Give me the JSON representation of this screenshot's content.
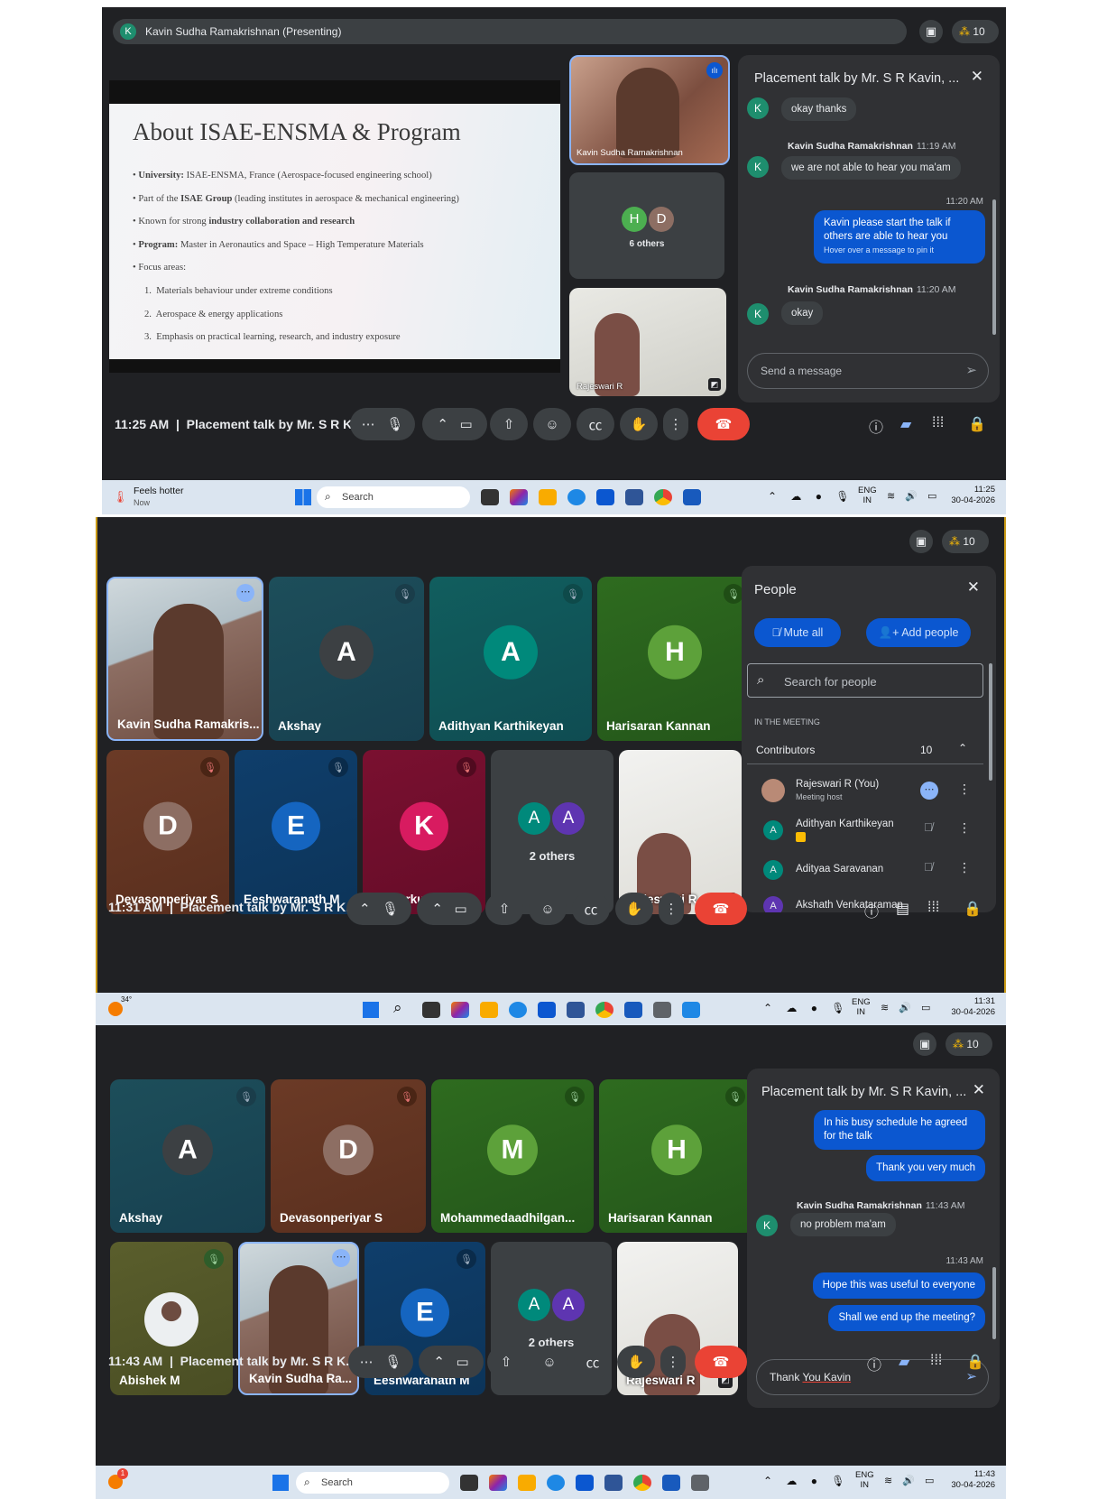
{
  "s1": {
    "presenting": "Kavin Sudha Ramakrishnan (Presenting)",
    "presenter_initial": "K",
    "count": "10",
    "slide": {
      "title": "About ISAE-ENSMA & Program",
      "b1_bold": "University:",
      "b1": " ISAE-ENSMA, France (Aerospace-focused engineering school)",
      "b2a": "Part of the ",
      "b2_bold": "ISAE Group",
      "b2b": " (leading institutes in aerospace & mechanical engineering)",
      "b3a": "Known for strong ",
      "b3_bold": "industry collaboration and research",
      "b4_bold": "Program:",
      "b4": " Master in Aeronautics and Space – High Temperature Materials",
      "b5": "Focus areas:",
      "n1": "Materials behaviour under extreme conditions",
      "n2": "Aerospace & energy applications",
      "n3": "Emphasis on practical learning, research, and industry exposure"
    },
    "tile_kavin": "Kavin Sudha Ramakrishnan",
    "others_label": "6 others",
    "others_i1": "H",
    "others_i2": "D",
    "tile_raj": "Rajeswari R",
    "chat": {
      "title": "Placement talk by Mr. S R Kavin, ...",
      "m0": "okay thanks",
      "sender1": "Kavin Sudha Ramakrishnan",
      "t1": "11:19 AM",
      "m1": "we are not able to hear you ma'am",
      "t2": "11:20 AM",
      "m2": "Kavin please start the talk if others are able to hear you",
      "m2_hint": "Hover over a message to pin it",
      "sender3": "Kavin Sudha Ramakrishnan",
      "t3": "11:20 AM",
      "m3": "okay",
      "input_placeholder": "Send a message"
    },
    "time": "11:25 AM",
    "meeting": "Placement talk by Mr. S R K...",
    "taskbar": {
      "weather": "Feels hotter",
      "weather_sub": "Now",
      "search": "Search",
      "lang1": "ENG",
      "lang2": "IN",
      "clock": "11:25",
      "date": "30-04-2026"
    }
  },
  "s2": {
    "count": "10",
    "tiles": [
      "Kavin Sudha Ramakris...",
      "Akshay",
      "Adithyan Karthikeyan",
      "Harisaran Kannan",
      "Devasonperiyar S",
      "Eeshwaranath M",
      "Kishorkumaar A",
      "2 others",
      "Rajeswari R"
    ],
    "initials": [
      "A",
      "A",
      "H",
      "D",
      "E",
      "K",
      "A",
      "A"
    ],
    "people": {
      "title": "People",
      "mute_all": "Mute all",
      "add_people": "Add people",
      "search_placeholder": "Search for people",
      "section": "IN THE MEETING",
      "group": "Contributors",
      "group_count": "10",
      "p1": "Rajeswari R (You)",
      "p1_sub": "Meeting host",
      "p2": "Adithyan Karthikeyan",
      "p2_i": "A",
      "p3": "Adityaa Saravanan",
      "p3_i": "A",
      "p4": "Akshath Venkataraman",
      "p4_i": "A"
    },
    "time": "11:31 AM",
    "meeting": "Placement talk by Mr. S R K...",
    "taskbar": {
      "temp": "34°",
      "lang1": "ENG",
      "lang2": "IN",
      "clock": "11:31",
      "date": "30-04-2026"
    }
  },
  "s3": {
    "count": "10",
    "tiles": [
      "Akshay",
      "Devasonperiyar S",
      "Mohammedaadhilgan...",
      "Harisaran Kannan",
      "Abishek M",
      "Kavin Sudha Ra...",
      "Eeshwaranath M",
      "2 others",
      "Rajeswari R"
    ],
    "initials": [
      "A",
      "D",
      "M",
      "H",
      "E",
      "A",
      "A"
    ],
    "chat": {
      "title": "Placement talk by Mr. S R Kavin, ...",
      "m1": "In his busy schedule he agreed for the talk",
      "m2": "Thank you very much",
      "sender3": "Kavin Sudha Ramakrishnan",
      "t3": "11:43 AM",
      "m3": "no problem ma'am",
      "t4": "11:43 AM",
      "m4": "Hope this was useful to everyone",
      "m5": "Shall we end up the meeting?",
      "input_a": "Thank ",
      "input_b": "You Kavin"
    },
    "time": "11:43 AM",
    "meeting": "Placement talk by Mr. S R K...",
    "taskbar": {
      "badge": "1",
      "search": "Search",
      "lang1": "ENG",
      "lang2": "IN",
      "clock": "11:43",
      "date": "30-04-2026"
    }
  },
  "colors": {
    "bg": "#202124",
    "blue": "#0b57d0",
    "red": "#ea4335",
    "teal": "#1e8e6e"
  }
}
